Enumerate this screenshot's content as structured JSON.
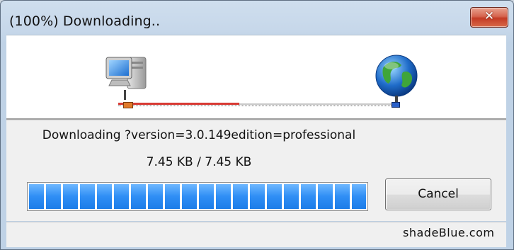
{
  "window": {
    "title": "(100%) Downloading..",
    "close_label": "✕"
  },
  "transfer": {
    "source_icon": "computer-icon",
    "destination_icon": "globe-icon",
    "track_progress": 0.43
  },
  "download": {
    "file_label": "Downloading ?version=3.0.149edition=professional",
    "size_label": "7.45 KB / 7.45 KB",
    "progress_percent": 100,
    "progress_color": "#2f8ef5"
  },
  "actions": {
    "cancel_label": "Cancel"
  },
  "footer": {
    "brand": "shadeBlue.com"
  },
  "colors": {
    "close_button": "#c43b25",
    "track_fill": "#d83a33"
  }
}
